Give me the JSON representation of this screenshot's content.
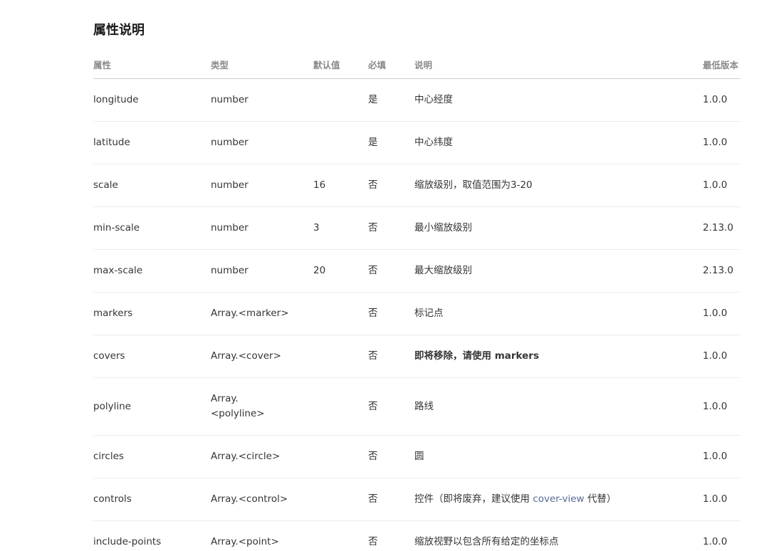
{
  "heading": "属性说明",
  "columns": [
    "属性",
    "类型",
    "默认值",
    "必填",
    "说明",
    "最低版本"
  ],
  "rows": [
    {
      "attr": "longitude",
      "type": "number",
      "default": "",
      "required": "是",
      "desc": "中心经度",
      "version": "1.0.0"
    },
    {
      "attr": "latitude",
      "type": "number",
      "default": "",
      "required": "是",
      "desc": "中心纬度",
      "version": "1.0.0"
    },
    {
      "attr": "scale",
      "type": "number",
      "default": "16",
      "required": "否",
      "desc": "缩放级别，取值范围为3-20",
      "version": "1.0.0"
    },
    {
      "attr": "min-scale",
      "type": "number",
      "default": "3",
      "required": "否",
      "desc": "最小缩放级别",
      "version": "2.13.0"
    },
    {
      "attr": "max-scale",
      "type": "number",
      "default": "20",
      "required": "否",
      "desc": "最大缩放级别",
      "version": "2.13.0"
    },
    {
      "attr": "markers",
      "type": "Array.<marker>",
      "default": "",
      "required": "否",
      "desc": "标记点",
      "version": "1.0.0"
    },
    {
      "attr": "covers",
      "type": "Array.<cover>",
      "default": "",
      "required": "否",
      "desc": "即将移除，请使用 markers",
      "version": "1.0.0"
    },
    {
      "attr": "polyline",
      "type_line1": "Array.",
      "type_line2": "<polyline>",
      "default": "",
      "required": "否",
      "desc": "路线",
      "version": "1.0.0"
    },
    {
      "attr": "circles",
      "type": "Array.<circle>",
      "default": "",
      "required": "否",
      "desc": "圆",
      "version": "1.0.0"
    },
    {
      "attr": "controls",
      "type": "Array.<control>",
      "default": "",
      "required": "否",
      "desc_pre": "控件（即将废弃，建议使用 ",
      "desc_link": "cover-view",
      "desc_post": " 代替）",
      "version": "1.0.0"
    },
    {
      "attr": "include-points",
      "type": "Array.<point>",
      "default": "",
      "required": "否",
      "desc": "缩放视野以包含所有给定的坐标点",
      "version": "1.0.0"
    }
  ]
}
